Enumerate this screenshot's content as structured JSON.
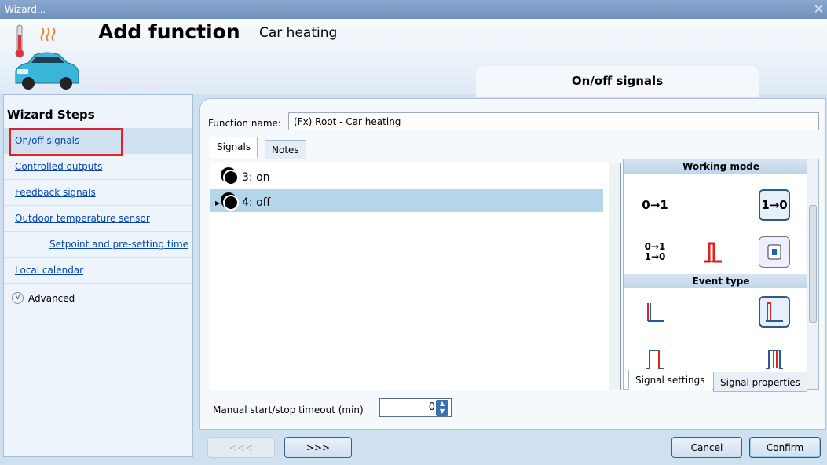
{
  "window": {
    "title": "Wizard..."
  },
  "header": {
    "title": "Add function",
    "subtitle": "Car heating",
    "step_tab": "On/off signals"
  },
  "sidebar": {
    "heading": "Wizard Steps",
    "steps": [
      {
        "label": "On/off signals"
      },
      {
        "label": "Controlled outputs"
      },
      {
        "label": "Feedback signals"
      },
      {
        "label": "Outdoor temperature sensor"
      },
      {
        "label": "Setpoint and pre-setting time"
      },
      {
        "label": "Local calendar"
      }
    ],
    "advanced": "Advanced"
  },
  "main": {
    "function_name_label": "Function name:",
    "function_name_value": "(Fx) Root - Car heating",
    "tabs": [
      "Signals",
      "Notes"
    ],
    "signals": [
      {
        "label": "3: on",
        "selected": false
      },
      {
        "label": "4: off",
        "selected": true
      }
    ],
    "working_mode_title": "Working mode",
    "working_mode_icons": [
      "0→1",
      "1→0",
      "0→1 1→0",
      "pulse-edge-icon",
      "switch-icon"
    ],
    "event_type_title": "Event type",
    "panel_tabs": [
      "Signal settings",
      "Signal properties"
    ],
    "timeout_label": "Manual start/stop timeout (min)",
    "timeout_value": "0"
  },
  "footer": {
    "prev": "<<<",
    "next": ">>>",
    "cancel": "Cancel",
    "confirm": "Confirm"
  },
  "colors": {
    "accent": "#2d5a8a",
    "selection": "#b3d6ea",
    "highlight": "#e0202a"
  }
}
